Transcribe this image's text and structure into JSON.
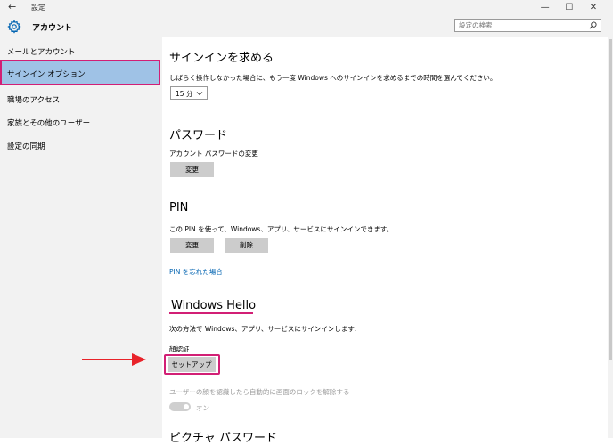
{
  "window": {
    "title": "設定",
    "back_icon": "arrow-left-icon",
    "controls": [
      "—",
      "☐",
      "✕"
    ]
  },
  "app": {
    "name": "アカウント",
    "icon": "gear-icon"
  },
  "search": {
    "placeholder": "設定の検索",
    "icon": "search-icon"
  },
  "sidebar": {
    "items": [
      {
        "label": "メールとアカウント"
      },
      {
        "label": "サインイン オプション",
        "selected": true
      },
      {
        "label": "職場のアクセス"
      },
      {
        "label": "家族とその他のユーザー"
      },
      {
        "label": "設定の同期"
      }
    ]
  },
  "signin": {
    "title": "サインインを求める",
    "desc": "しばらく操作しなかった場合に、もう一度 Windows へのサインインを求めるまでの時間を選んでください。",
    "dropdown_value": "15 分"
  },
  "password": {
    "title": "パスワード",
    "desc": "アカウント パスワードの変更",
    "change_label": "変更"
  },
  "pin": {
    "title": "PIN",
    "desc": "この PIN を使って、Windows、アプリ、サービスにサインインできます。",
    "change_label": "変更",
    "remove_label": "削除",
    "forgot_link": "PIN を忘れた場合"
  },
  "hello": {
    "title": "Windows Hello",
    "desc": "次の方法で Windows、アプリ、サービスにサインインします:",
    "face_label": "顔認証",
    "setup_label": "セットアップ",
    "auto_unlock": "ユーザーの顔を認識したら自動的に画面のロックを解除する",
    "toggle_state": "オン"
  },
  "picture_password": {
    "title": "ピクチャ パスワード"
  },
  "colors": {
    "accent": "#0063b1",
    "highlight": "#d21f75",
    "sidebar_bg": "#f2f2f2",
    "selected_bg": "#9fc2e6"
  }
}
